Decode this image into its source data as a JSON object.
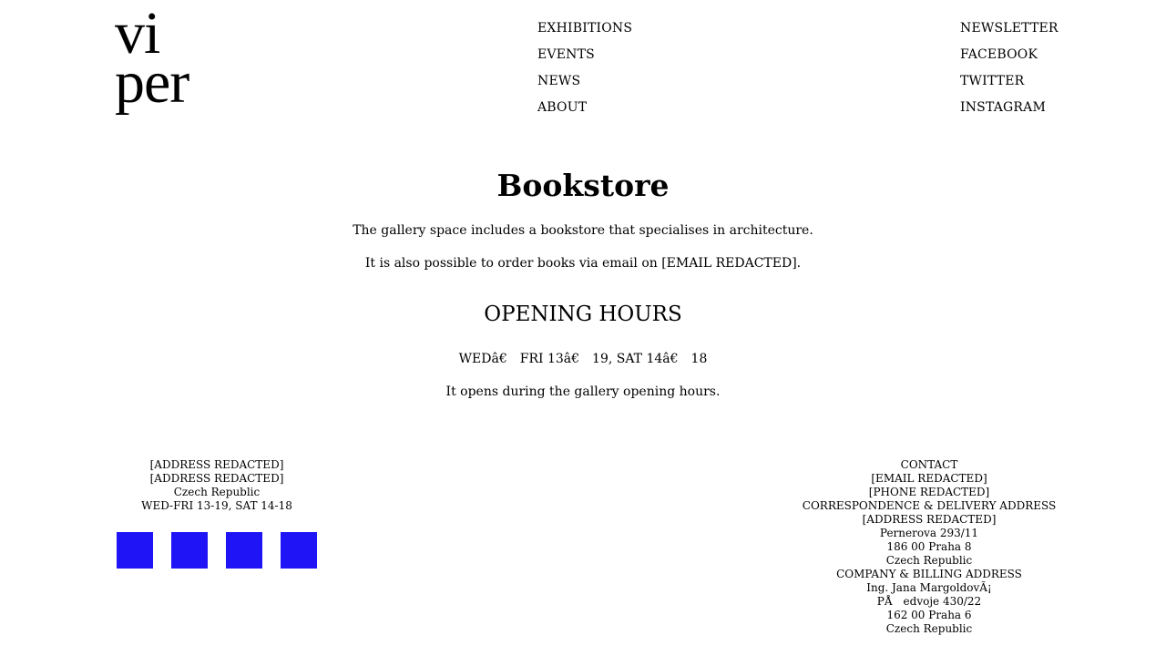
{
  "logo": {
    "line1": "vi",
    "line2": "per"
  },
  "nav_main": [
    "EXHIBITIONS",
    "EVENTS",
    "NEWS",
    "ABOUT"
  ],
  "nav_social": [
    "NEWSLETTER",
    "FACEBOOK",
    "TWITTER",
    "INSTAGRAM"
  ],
  "main": {
    "title": "Bookstore",
    "paragraph1": "The gallery space includes a bookstore that specialises in architecture.",
    "paragraph2": "It is also possible to order books via email on [EMAIL REDACTED].",
    "subtitle": "OPENING HOURS",
    "hours": "WEDâ€ FRI 13â€ 19, SAT 14â€ 18",
    "note": "It opens during the gallery opening hours."
  },
  "footer_left": {
    "address": [
      "[ADDRESS REDACTED]",
      "[ADDRESS REDACTED]",
      "Czech Republic",
      "WED-FRI 13-19, SAT 14-18"
    ],
    "squares_color": "#1e14f5"
  },
  "footer_right": {
    "lines": [
      "CONTACT",
      "[EMAIL REDACTED]",
      "[PHONE REDACTED]",
      "CORRESPONDENCE & DELIVERY ADDRESS",
      "[ADDRESS REDACTED]",
      "Pernerova 293/11",
      "186 00 Praha 8",
      "Czech Republic",
      "COMPANY & BILLING ADDRESS",
      "Ing. Jana MargoldovÃ¡",
      "PÅ edvoje 430/22",
      "162 00 Praha 6",
      "Czech Republic"
    ]
  }
}
